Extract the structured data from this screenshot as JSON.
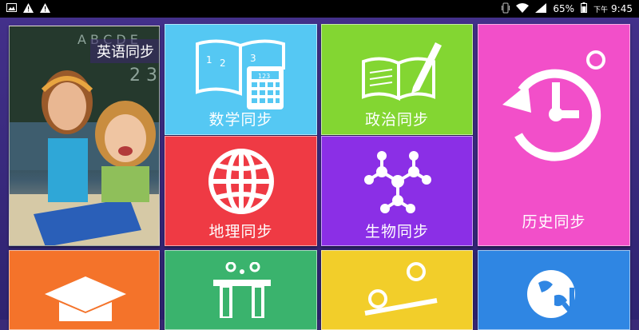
{
  "status_bar": {
    "battery": "65%",
    "time_prefix": "下午",
    "time": "9:45",
    "icons": [
      "image-icon",
      "warning-icon",
      "warning-icon",
      "vibrate-icon",
      "wifi-icon",
      "signal-icon",
      "battery-icon"
    ]
  },
  "tiles": {
    "english": {
      "label": "英语同步",
      "color": "#2e6a4a"
    },
    "math": {
      "label": "数学同步",
      "color": "#55c8f3"
    },
    "politics": {
      "label": "政治同步",
      "color": "#83d632"
    },
    "history": {
      "label": "历史同步",
      "color": "#f24fc9"
    },
    "geography": {
      "label": "地理同步",
      "color": "#ef3a44"
    },
    "biology": {
      "label": "生物同步",
      "color": "#8b2fe6"
    },
    "bottom_1": {
      "label": "",
      "color": "#f4732a"
    },
    "bottom_2": {
      "label": "",
      "color": "#3ab36d"
    },
    "bottom_3": {
      "label": "",
      "color": "#f2ce2a"
    },
    "bottom_4": {
      "label": "",
      "color": "#2f86e3"
    }
  }
}
